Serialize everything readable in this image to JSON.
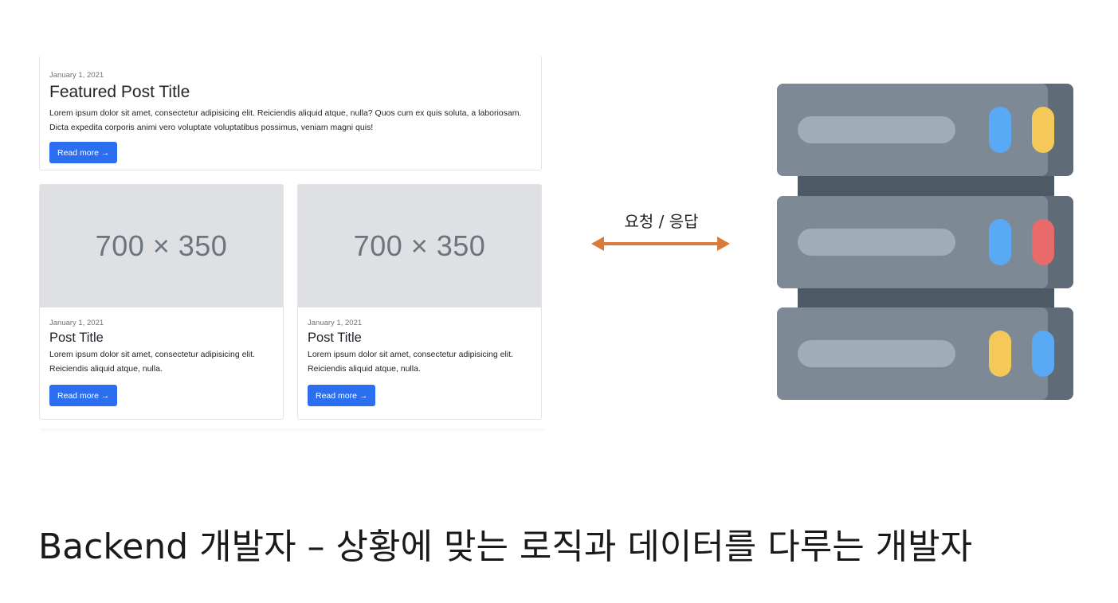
{
  "featured": {
    "date": "January 1, 2021",
    "title": "Featured Post Title",
    "excerpt": "Lorem ipsum dolor sit amet, consectetur adipisicing elit. Reiciendis aliquid atque, nulla? Quos cum ex quis soluta, a laboriosam. Dicta expedita corporis animi vero voluptate voluptatibus possimus, veniam magni quis!",
    "button_label": "Read more →"
  },
  "posts": [
    {
      "placeholder": "700 × 350",
      "date": "January 1, 2021",
      "title": "Post Title",
      "excerpt": "Lorem ipsum dolor sit amet, consectetur adipisicing elit. Reiciendis aliquid atque, nulla.",
      "button_label": "Read more →"
    },
    {
      "placeholder": "700 × 350",
      "date": "January 1, 2021",
      "title": "Post Title",
      "excerpt": "Lorem ipsum dolor sit amet, consectetur adipisicing elit. Reiciendis aliquid atque, nulla.",
      "button_label": "Read more →"
    }
  ],
  "diagram": {
    "arrow_label": "요청 / 응답",
    "arrow_color": "#d97a3a",
    "server_icon": "server-rack-icon",
    "server_lights": [
      [
        "#5aa9f5",
        "#f5c85a"
      ],
      [
        "#5aa9f5",
        "#e86a6a"
      ],
      [
        "#f5c85a",
        "#5aa9f5"
      ]
    ]
  },
  "caption": "Backend 개발자 – 상황에 맞는 로직과 데이터를 다루는 개발자",
  "colors": {
    "button": "#2b6ff0",
    "placeholder_bg": "#dfe0e3"
  }
}
